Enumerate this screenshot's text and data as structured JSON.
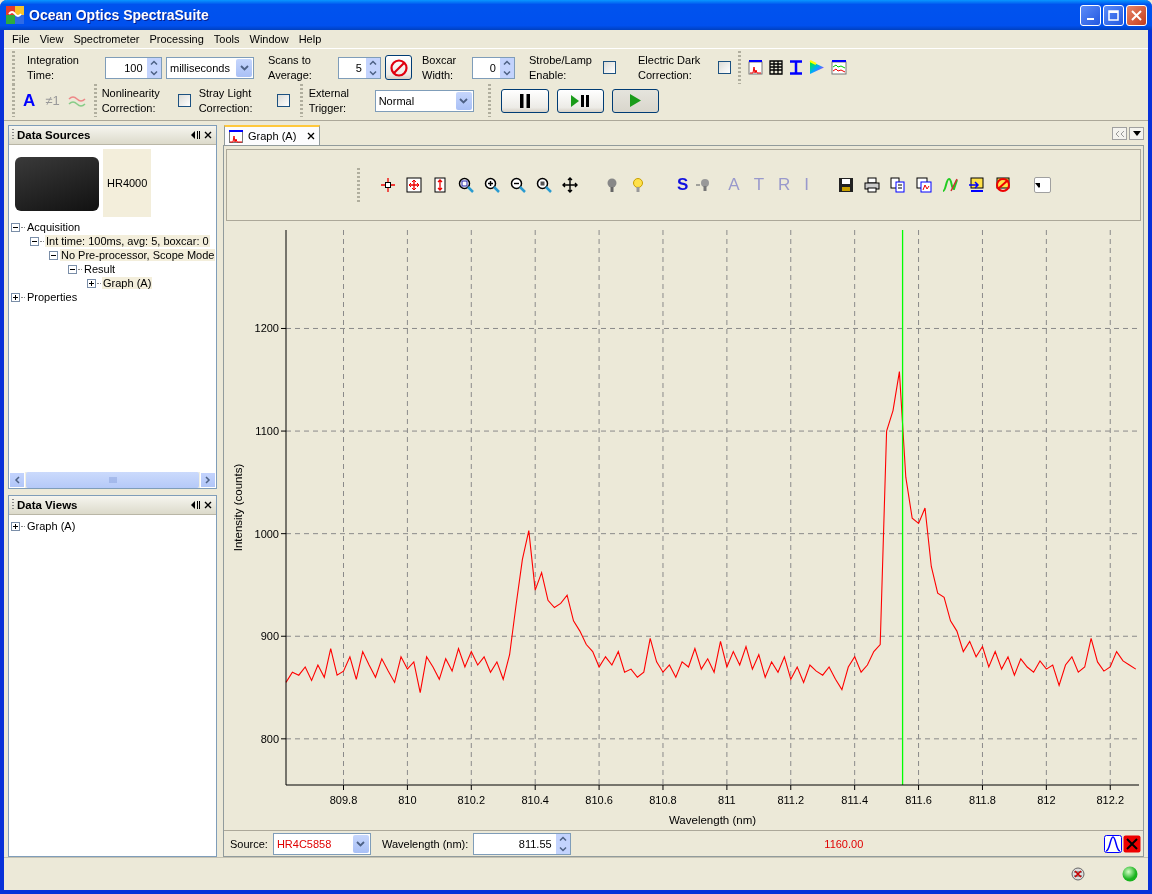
{
  "window": {
    "title": "Ocean Optics SpectraSuite"
  },
  "menu": [
    "File",
    "View",
    "Spectrometer",
    "Processing",
    "Tools",
    "Window",
    "Help"
  ],
  "toolbar": {
    "integration_time": {
      "label": "Integration Time:",
      "value": "100",
      "unit": "milliseconds"
    },
    "scans_to_average": {
      "label": "Scans to Average:",
      "value": "5"
    },
    "boxcar_width": {
      "label": "Boxcar Width:",
      "value": "0"
    },
    "strobe_lamp_enable": {
      "label": "Strobe/Lamp Enable:",
      "checked": false
    },
    "electric_dark_correction": {
      "label": "Electric Dark Correction:",
      "checked": false
    },
    "mode_glyphs": [
      "A",
      "≠1"
    ],
    "nonlinearity_correction": {
      "label": "Nonlinearity Correction:",
      "checked": false
    },
    "stray_light_correction": {
      "label": "Stray Light Correction:",
      "checked": false
    },
    "external_trigger": {
      "label": "External Trigger:",
      "value": "Normal"
    }
  },
  "data_sources": {
    "title": "Data Sources",
    "device": "HR4000",
    "tree": [
      {
        "label": "Acquisition",
        "expanded": true,
        "highlighted": false,
        "children": [
          {
            "label": "Int time: 100ms, avg: 5, boxcar: 0",
            "expanded": true,
            "highlighted": true,
            "children": [
              {
                "label": "No Pre-processor, Scope Mode",
                "expanded": true,
                "highlighted": true,
                "children": [
                  {
                    "label": "Result",
                    "expanded": true,
                    "highlighted": false,
                    "children": [
                      {
                        "label": "Graph (A)",
                        "expanded": false,
                        "highlighted": true
                      }
                    ]
                  }
                ]
              }
            ]
          }
        ]
      },
      {
        "label": "Properties",
        "expanded": false,
        "highlighted": false
      }
    ]
  },
  "data_views": {
    "title": "Data Views",
    "tree": [
      {
        "label": "Graph (A)",
        "expanded": false,
        "highlighted": false
      }
    ]
  },
  "graph": {
    "tabs": [
      {
        "label": "Graph (A)",
        "selected": true
      }
    ],
    "toolbar_letters": [
      {
        "label": "S",
        "enabled": true
      },
      {
        "label": "A",
        "enabled": false
      },
      {
        "label": "T",
        "enabled": false
      },
      {
        "label": "R",
        "enabled": false
      },
      {
        "label": "I",
        "enabled": false
      }
    ],
    "chart_data": {
      "type": "line",
      "xlabel": "Wavelength (nm)",
      "ylabel": "Intensity (counts)",
      "x": [
        809.62,
        809.64,
        809.66,
        809.68,
        809.7,
        809.72,
        809.74,
        809.76,
        809.78,
        809.8,
        809.82,
        809.84,
        809.86,
        809.88,
        809.9,
        809.92,
        809.94,
        809.96,
        809.98,
        810.0,
        810.02,
        810.04,
        810.06,
        810.08,
        810.1,
        810.12,
        810.14,
        810.16,
        810.18,
        810.2,
        810.22,
        810.24,
        810.26,
        810.28,
        810.3,
        810.32,
        810.34,
        810.36,
        810.38,
        810.4,
        810.42,
        810.44,
        810.46,
        810.48,
        810.5,
        810.52,
        810.54,
        810.56,
        810.58,
        810.6,
        810.62,
        810.64,
        810.66,
        810.68,
        810.7,
        810.72,
        810.74,
        810.76,
        810.78,
        810.8,
        810.82,
        810.84,
        810.86,
        810.88,
        810.9,
        810.92,
        810.94,
        810.96,
        810.98,
        811.0,
        811.02,
        811.04,
        811.06,
        811.08,
        811.1,
        811.12,
        811.14,
        811.16,
        811.18,
        811.2,
        811.22,
        811.24,
        811.26,
        811.28,
        811.3,
        811.32,
        811.34,
        811.36,
        811.38,
        811.4,
        811.42,
        811.44,
        811.46,
        811.48,
        811.5,
        811.52,
        811.54,
        811.56,
        811.58,
        811.6,
        811.62,
        811.64,
        811.66,
        811.68,
        811.7,
        811.72,
        811.74,
        811.76,
        811.78,
        811.8,
        811.82,
        811.84,
        811.86,
        811.88,
        811.9,
        811.92,
        811.94,
        811.96,
        811.98,
        812.0,
        812.02,
        812.04,
        812.06,
        812.08,
        812.1,
        812.12,
        812.14,
        812.16,
        812.18,
        812.2,
        812.22,
        812.24,
        812.26,
        812.28
      ],
      "series": [
        {
          "color": "#ff0000",
          "values": [
            855,
            865,
            862,
            870,
            857,
            872,
            860,
            888,
            862,
            866,
            880,
            858,
            885,
            872,
            860,
            878,
            866,
            855,
            880,
            868,
            875,
            845,
            880,
            870,
            858,
            878,
            866,
            888,
            870,
            885,
            872,
            880,
            865,
            875,
            858,
            882,
            930,
            975,
            1003,
            945,
            962,
            935,
            928,
            932,
            940,
            915,
            905,
            892,
            885,
            870,
            880,
            872,
            885,
            865,
            868,
            860,
            865,
            898,
            875,
            865,
            872,
            860,
            875,
            870,
            888,
            868,
            878,
            865,
            895,
            870,
            885,
            872,
            890,
            868,
            882,
            860,
            875,
            865,
            880,
            858,
            870,
            855,
            872,
            866,
            862,
            870,
            858,
            848,
            870,
            880,
            865,
            872,
            885,
            892,
            1100,
            1120,
            1158,
            1055,
            1015,
            1010,
            1025,
            968,
            942,
            938,
            915,
            905,
            885,
            895,
            880,
            890,
            870,
            885,
            868,
            880,
            862,
            878,
            870,
            865,
            876,
            868,
            872,
            852,
            872,
            880,
            865,
            870,
            898,
            875,
            866,
            870,
            885,
            876,
            872,
            868
          ]
        }
      ],
      "xlim": [
        809.62,
        812.29
      ],
      "ylim": [
        755,
        1296
      ],
      "xticks": [
        809.8,
        810,
        810.2,
        810.4,
        810.6,
        810.8,
        811,
        811.2,
        811.4,
        811.6,
        811.8,
        812,
        812.2
      ],
      "yticks": [
        800,
        900,
        1000,
        1100,
        1200
      ],
      "grid": true,
      "ref_lines": [
        {
          "axis": "x",
          "value": 811.55,
          "color": "#00ff00"
        }
      ]
    },
    "source": {
      "label": "Source:",
      "value": "HR4C5858"
    },
    "wavelength": {
      "label": "Wavelength (nm):",
      "value": "811.55"
    },
    "reading": "1160.00"
  }
}
